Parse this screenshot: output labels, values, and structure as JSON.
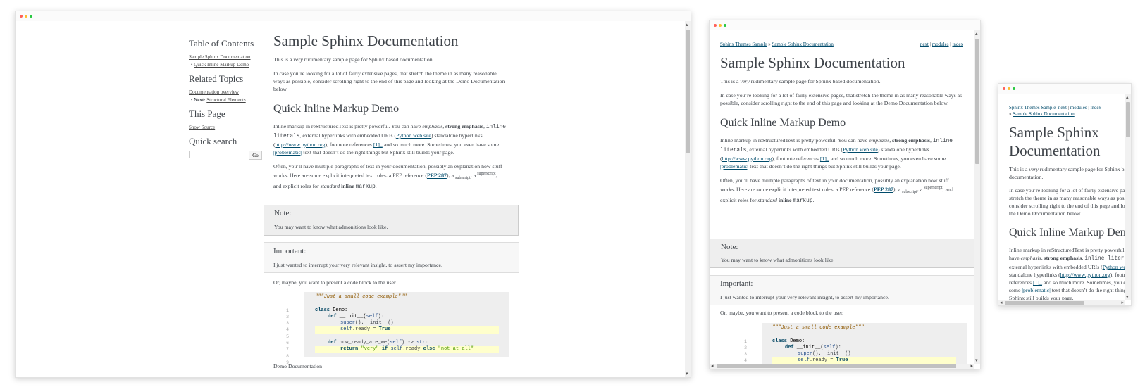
{
  "doc": {
    "title": "Sample Sphinx Documentation",
    "intro_pre": "This is a ",
    "intro_em": "very",
    "intro_post": " rudimentary sample page for Sphinx based documentation.",
    "para2": "In case you’re looking for a lot of fairly extensive pages, that stretch the theme in as many reasonable ways as possible, consider scrolling right to the end of this page and looking at the Demo Documentation below.",
    "section_title": "Quick Inline Markup Demo",
    "markup": {
      "t1": "Inline markup in reStructuredText is pretty powerful. You can have ",
      "emphasis": "emphasis",
      "t2": ", ",
      "strong": "strong emphasis",
      "t3": ", ",
      "literals": "inline literals",
      "t4": ", external hyperlinks with embedded URIs (",
      "python_link": "Python web site",
      "t5": ") standalone hyperlinks (",
      "standalone_link": "http://www.python.org",
      "t6": "), footnote references ",
      "footnote": "[1]_",
      "t7": " and so much more. Sometimes, you even have some ",
      "problematic": "|problematic|",
      "t8": " text that doesn’t do the right things but Sphinx still builds your page."
    },
    "roles": {
      "t1": "Often, you’ll have multiple paragraphs of text in your documentation, possibly an explanation how stuff works. Here are some explicit interpreted text roles: a PEP reference (",
      "pep": "PEP 287",
      "t2": "); a ",
      "subscript": "subscript",
      "t3": "; a ",
      "superscript": "superscript",
      "t4": "; and explicit roles for ",
      "standard": "standard",
      "t5": " ",
      "inline": "inline",
      "t6": " ",
      "markup": "markup",
      "t7": "."
    },
    "note_title": "Note:",
    "note_body": "You may want to know what admonitions look like.",
    "important_title": "Important:",
    "important_body": "I just wanted to interrupt your very relevant insight, to assert my importance.",
    "code_intro": "Or, maybe, you want to present a code block to the user.",
    "code": {
      "line_numbers": [
        "1",
        "2",
        "3",
        "4",
        "5",
        "6",
        "7",
        "8",
        "9"
      ],
      "l1": "\"\"\"Just a small code example\"\"\"",
      "l3_kw": "class",
      "l3_name": " Demo:",
      "l4_kw": "def",
      "l4_name": " __init__(",
      "l4_self": "self",
      "l4_end": "):",
      "l5_super": "super",
      "l5_rest": "().__init__()",
      "l6_self": "self",
      "l6_mid": ".ready ",
      "l6_eq": "=",
      "l6_true": " True",
      "l8_kw": "def",
      "l8_name": " how_ready_are_we(",
      "l8_self": "self",
      "l8_mid": ") -> ",
      "l8_str": "str",
      "l8_end": ":",
      "l9_ret": "return",
      "l9_s1": " \"very\"",
      "l9_if": " if ",
      "l9_self": "self",
      "l9_mid": ".ready ",
      "l9_else": "else",
      "l9_s2": " \"not at all\""
    },
    "demo_heading": "Demo Documentation"
  },
  "sidebar": {
    "toc_title": "Table of Contents",
    "toc_link": "Sample Sphinx Documentation",
    "toc_sub": "Quick Inline Markup Demo",
    "related_title": "Related Topics",
    "related_link": "Documentation overview",
    "next_label": "Next:",
    "next_link": "Structural Elements",
    "thispage_title": "This Page",
    "show_source": "Show Source",
    "search_title": "Quick search",
    "search_button": "Go",
    "search_value": ""
  },
  "relbar": {
    "crumb_root": "Sphinx Themes Sample",
    "crumb_sep": "»",
    "crumb_current": "Sample Sphinx Documentation",
    "next": "next",
    "modules": "modules",
    "index": "index",
    "sep": "|"
  },
  "colors": {
    "link": "#004b6b",
    "note_bg": "#eeeeee",
    "code_bg": "#eeeeee",
    "highlight": "#ffffcc"
  }
}
